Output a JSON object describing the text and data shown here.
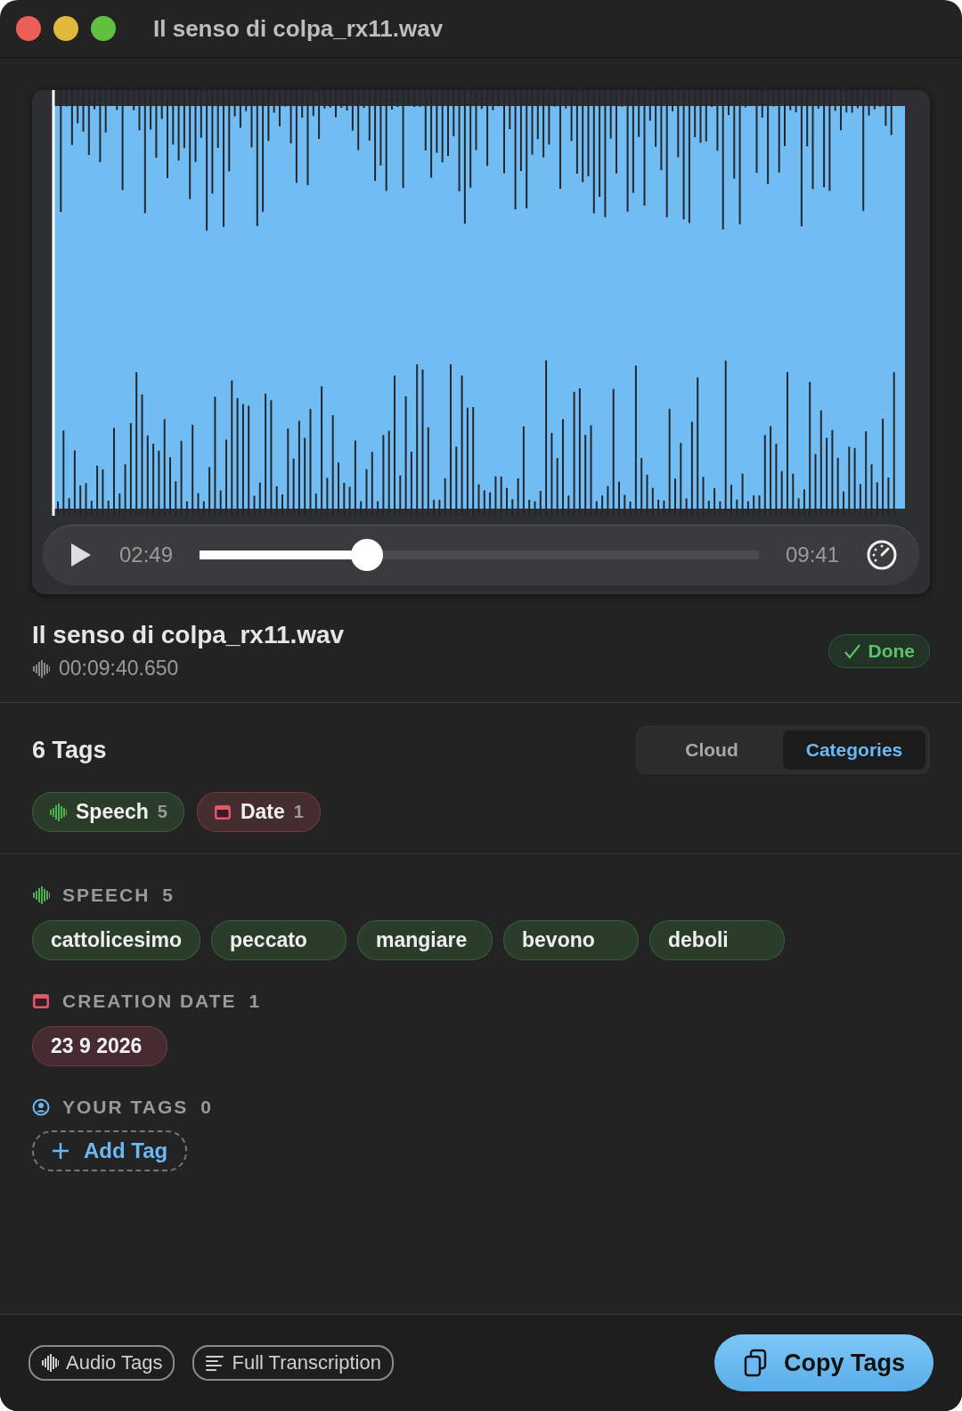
{
  "window": {
    "title": "Il senso di colpa_rx11.wav"
  },
  "player": {
    "elapsed": "02:49",
    "level": 0.3,
    "duration": "09:41"
  },
  "file": {
    "name": "Il senso di colpa_rx11.wav",
    "duration": "00:09:40.650",
    "status": "Done"
  },
  "tags_header": {
    "title": "6 Tags",
    "tabs": [
      {
        "label": "Cloud",
        "selected": false
      },
      {
        "label": "Categories",
        "selected": true
      }
    ]
  },
  "categories": [
    {
      "kind": "speech",
      "label": "Speech",
      "count": "5",
      "color": "#4cb050"
    },
    {
      "kind": "date",
      "label": "Date",
      "count": "1",
      "color": "#e0566a"
    }
  ],
  "sections": [
    {
      "kind": "speech",
      "title": "SPEECH",
      "count": "5",
      "color": "#4cb050",
      "tags": [
        "cattolicesimo",
        "peccato",
        "mangiare",
        "bevono",
        "deboli"
      ]
    },
    {
      "kind": "date",
      "title": "CREATION DATE",
      "count": "1",
      "color": "#e0566a",
      "tags": [
        "23 9 2026"
      ]
    },
    {
      "kind": "user",
      "title": "YOUR TAGS",
      "count": "0",
      "color": "#6cb8f2",
      "add_button": "Add Tag"
    }
  ],
  "footer": {
    "buttons": [
      {
        "kind": "audio",
        "label": "Audio Tags"
      },
      {
        "kind": "transcript",
        "label": "Full Transcription"
      }
    ],
    "copy_button": "Copy Tags"
  }
}
